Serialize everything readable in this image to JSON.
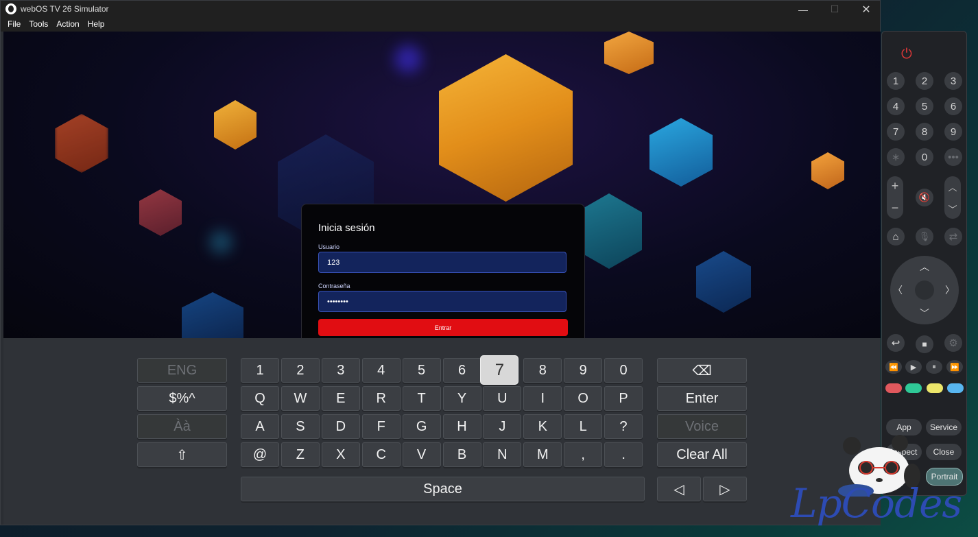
{
  "window": {
    "title": "webOS TV 26 Simulator",
    "controls": {
      "minimize": "—",
      "maximize": "☐",
      "close": "✕"
    },
    "menu": [
      "File",
      "Tools",
      "Action",
      "Help"
    ]
  },
  "login": {
    "heading": "Inicia sesión",
    "user_label": "Usuario",
    "user_value": "123",
    "pass_label": "Contraseña",
    "pass_value": "••••••••",
    "submit": "Entrar"
  },
  "keyboard": {
    "left": [
      "ENG",
      "$%^",
      "Àà",
      "⇧"
    ],
    "rows": [
      [
        "1",
        "2",
        "3",
        "4",
        "5",
        "6",
        "7",
        "8",
        "9",
        "0"
      ],
      [
        "Q",
        "W",
        "E",
        "R",
        "T",
        "Y",
        "U",
        "I",
        "O",
        "P"
      ],
      [
        "A",
        "S",
        "D",
        "F",
        "G",
        "H",
        "J",
        "K",
        "L",
        "?"
      ],
      [
        "@",
        "Z",
        "X",
        "C",
        "V",
        "B",
        "N",
        "M",
        ",",
        "."
      ]
    ],
    "highlighted": "7",
    "right": [
      "⌫",
      "Enter",
      "Voice",
      "Clear All"
    ],
    "space": "Space",
    "arrows": [
      "◁",
      "▷"
    ]
  },
  "remote": {
    "power": "⏻",
    "digits": [
      "1",
      "2",
      "3",
      "4",
      "5",
      "6",
      "7",
      "8",
      "9",
      "∗",
      "0",
      "•••"
    ],
    "vol_plus": "+",
    "vol_minus": "−",
    "mute": "🔇",
    "ch_up": "︿",
    "ch_down": "﹀",
    "home": "⌂",
    "mic": "🎙",
    "input": "⇄",
    "dpad": {
      "up": "︿",
      "down": "﹀",
      "left": "〈",
      "right": "〉"
    },
    "back": "↩",
    "stop": "■",
    "settings": "⚙",
    "media": [
      "⏪",
      "▶",
      "⏸",
      "⏩"
    ],
    "colors": [
      "#e0585d",
      "#2fc997",
      "#ece66a",
      "#58b6f0"
    ],
    "pills": [
      "App",
      "Service",
      "Inspect",
      "Close",
      "Portrait"
    ]
  },
  "watermark": "LpCodes"
}
